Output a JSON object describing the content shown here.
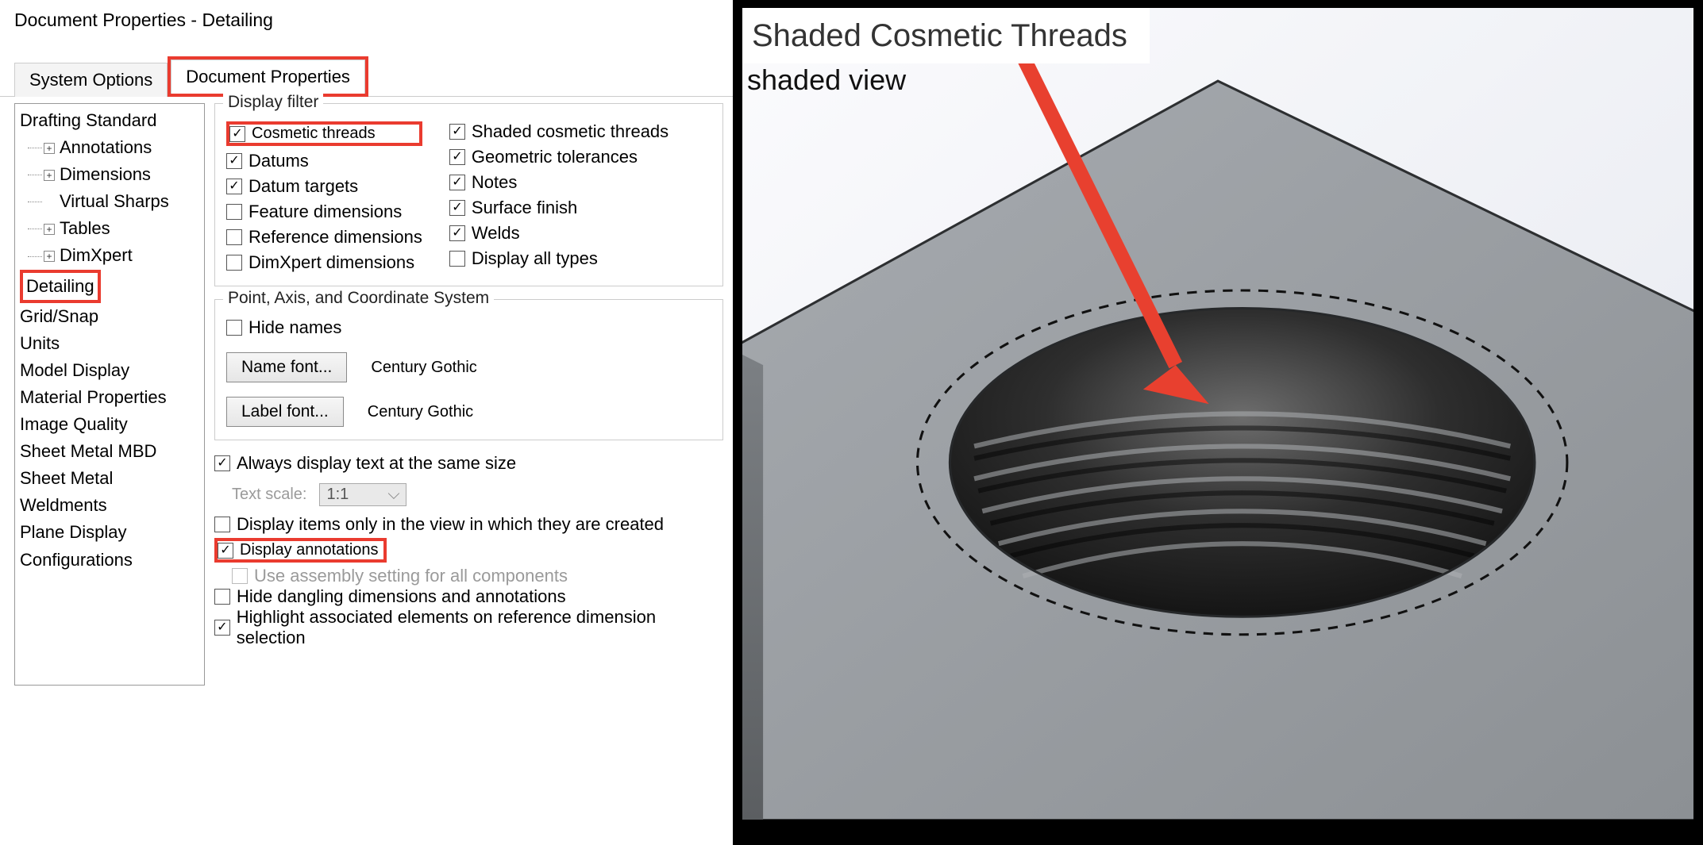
{
  "window": {
    "title": "Document Properties - Detailing"
  },
  "tabs": {
    "system": "System Options",
    "document": "Document Properties"
  },
  "tree": {
    "drafting": "Drafting Standard",
    "annotations": "Annotations",
    "dimensions": "Dimensions",
    "virtualSharps": "Virtual Sharps",
    "tables": "Tables",
    "dimxpert": "DimXpert",
    "detailing": "Detailing",
    "gridsnap": "Grid/Snap",
    "units": "Units",
    "modelDisplay": "Model Display",
    "materialProps": "Material Properties",
    "imageQuality": "Image Quality",
    "sheetMetalMBD": "Sheet Metal MBD",
    "sheetMetal": "Sheet Metal",
    "weldments": "Weldments",
    "planeDisplay": "Plane Display",
    "configurations": "Configurations"
  },
  "displayFilter": {
    "legend": "Display filter",
    "cosmeticThreads": "Cosmetic threads",
    "datums": "Datums",
    "datumTargets": "Datum targets",
    "featureDims": "Feature dimensions",
    "refDims": "Reference dimensions",
    "dimxpertDims": "DimXpert dimensions",
    "shadedCosmetic": "Shaded cosmetic threads",
    "geoTol": "Geometric tolerances",
    "notes": "Notes",
    "surfaceFinish": "Surface finish",
    "welds": "Welds",
    "displayAll": "Display all types"
  },
  "coordGroup": {
    "legend": "Point, Axis, and Coordinate System",
    "hideNames": "Hide names",
    "nameFontBtn": "Name font...",
    "labelFontBtn": "Label font...",
    "nameFontValue": "Century Gothic",
    "labelFontValue": "Century Gothic"
  },
  "annotationOpts": {
    "alwaysSize": "Always display text at the same size",
    "textScaleLabel": "Text scale:",
    "textScaleValue": "1:1",
    "onlyInView": "Display items only in the view in which they are created",
    "displayAnnotations": "Display annotations",
    "assemblySetting": "Use assembly setting for all components",
    "hideDangling": "Hide dangling dimensions and annotations",
    "highlightAssoc": "Highlight associated elements on reference dimension selection"
  },
  "right": {
    "callout": "Shaded Cosmetic Threads",
    "subcaption": "shaded view"
  }
}
